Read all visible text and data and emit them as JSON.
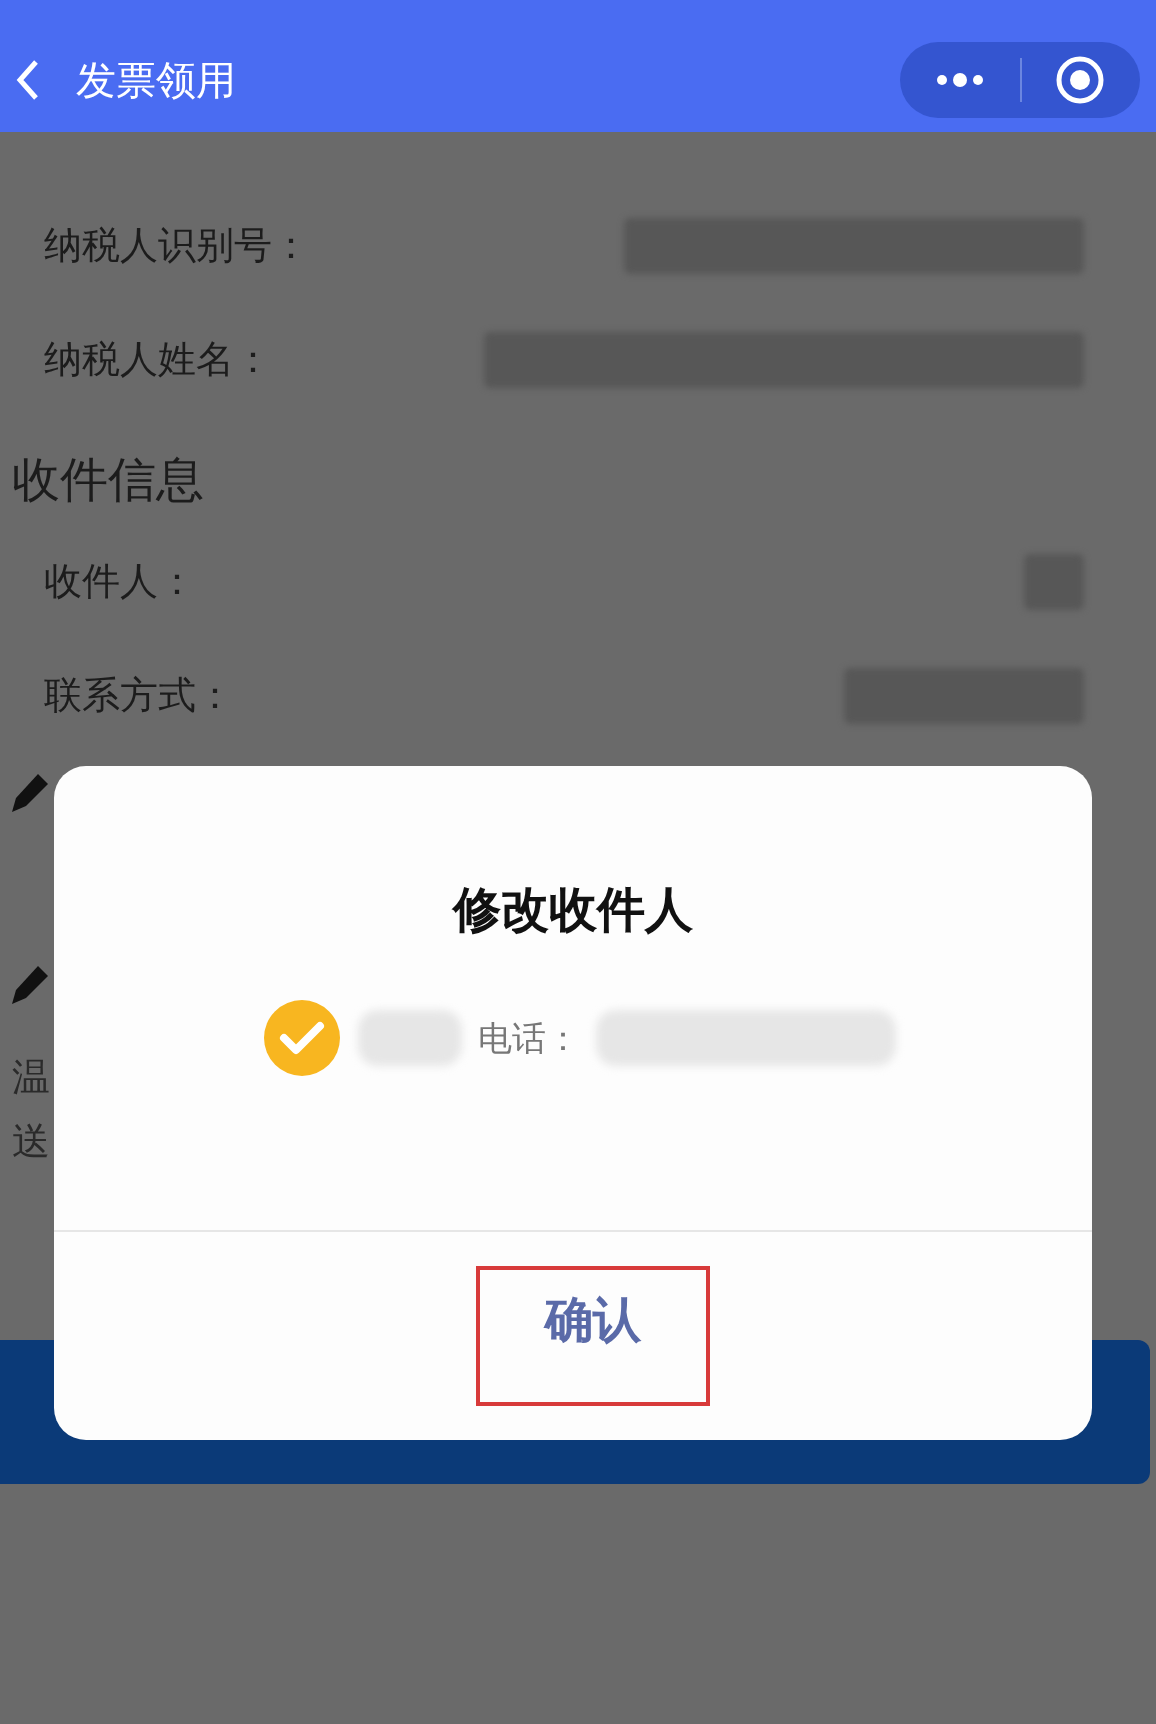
{
  "header": {
    "title": "发票领用"
  },
  "taxpayer_fields": [
    {
      "label": "纳税人识别号："
    },
    {
      "label": "纳税人姓名："
    }
  ],
  "section": {
    "title": "收件信息"
  },
  "recipient_fields": [
    {
      "label": "收件人："
    },
    {
      "label": "联系方式："
    }
  ],
  "note_fragments": [
    "温",
    "送"
  ],
  "dialog": {
    "title": "修改收件人",
    "options": [
      {
        "label": "电话：",
        "selected": true
      }
    ],
    "confirm": {
      "label": "确认",
      "annotated": true
    }
  }
}
